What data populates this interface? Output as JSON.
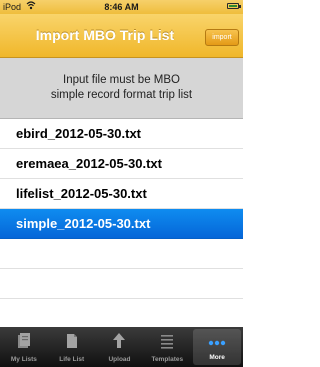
{
  "status_bar": {
    "carrier": "iPod",
    "time": "8:46 AM"
  },
  "nav": {
    "title": "Import MBO Trip List",
    "import_button": "import"
  },
  "info": {
    "line1": "Input file must be MBO",
    "line2": "simple record format trip list"
  },
  "files": [
    {
      "name": "ebird_2012-05-30.txt",
      "selected": false
    },
    {
      "name": "eremaea_2012-05-30.txt",
      "selected": false
    },
    {
      "name": "lifelist_2012-05-30.txt",
      "selected": false
    },
    {
      "name": "simple_2012-05-30.txt",
      "selected": true
    }
  ],
  "tabs": [
    {
      "label": "My Lists",
      "icon": "my-lists-icon"
    },
    {
      "label": "Life List",
      "icon": "life-list-icon"
    },
    {
      "label": "Upload",
      "icon": "upload-icon"
    },
    {
      "label": "Templates",
      "icon": "templates-icon"
    },
    {
      "label": "More",
      "icon": "more-icon",
      "active": true
    }
  ],
  "colors": {
    "nav_gold": "#f0b72a",
    "selected_blue": "#0a79e6"
  }
}
